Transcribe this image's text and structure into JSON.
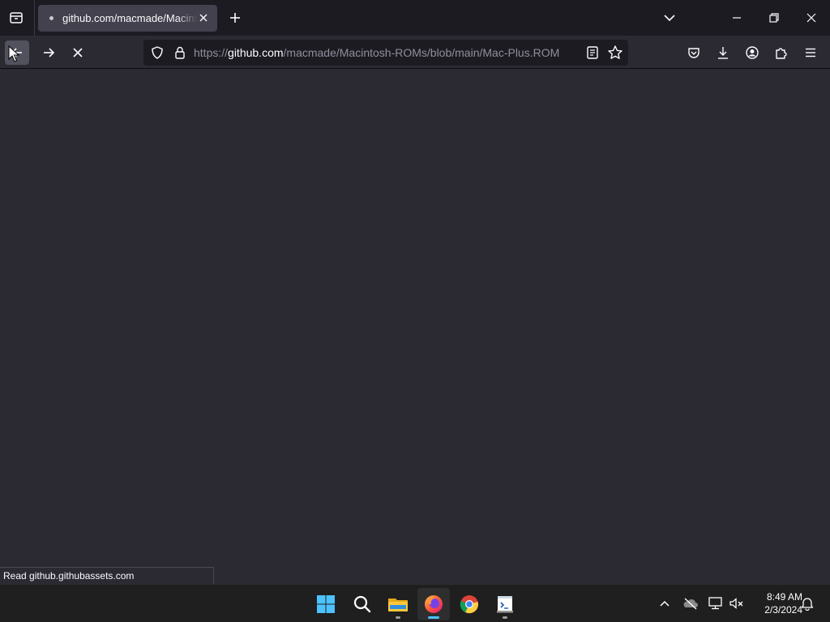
{
  "browser": {
    "tab": {
      "title": "github.com/macmade/Macintosh-ROMs/blob/main/Mac-Plus.ROM"
    },
    "url": {
      "scheme": "https://",
      "host": "github.com",
      "path": "/macmade/Macintosh-ROMs/blob/main/Mac-Plus.ROM"
    },
    "status": "Read github.githubassets.com"
  },
  "taskbar": {
    "apps": [
      "start-icon",
      "search-icon",
      "file-explorer-icon",
      "firefox-icon",
      "chrome-icon",
      "terminal-app-icon"
    ],
    "clock": {
      "time": "8:49 AM",
      "date": "2/3/2024"
    }
  },
  "colors": {
    "chrome_bg": "#1c1b22",
    "toolbar_bg": "#2b2a33",
    "tab_active": "#42414d",
    "taskbar_bg": "#1f1f1f",
    "accent": "#00ddff"
  }
}
